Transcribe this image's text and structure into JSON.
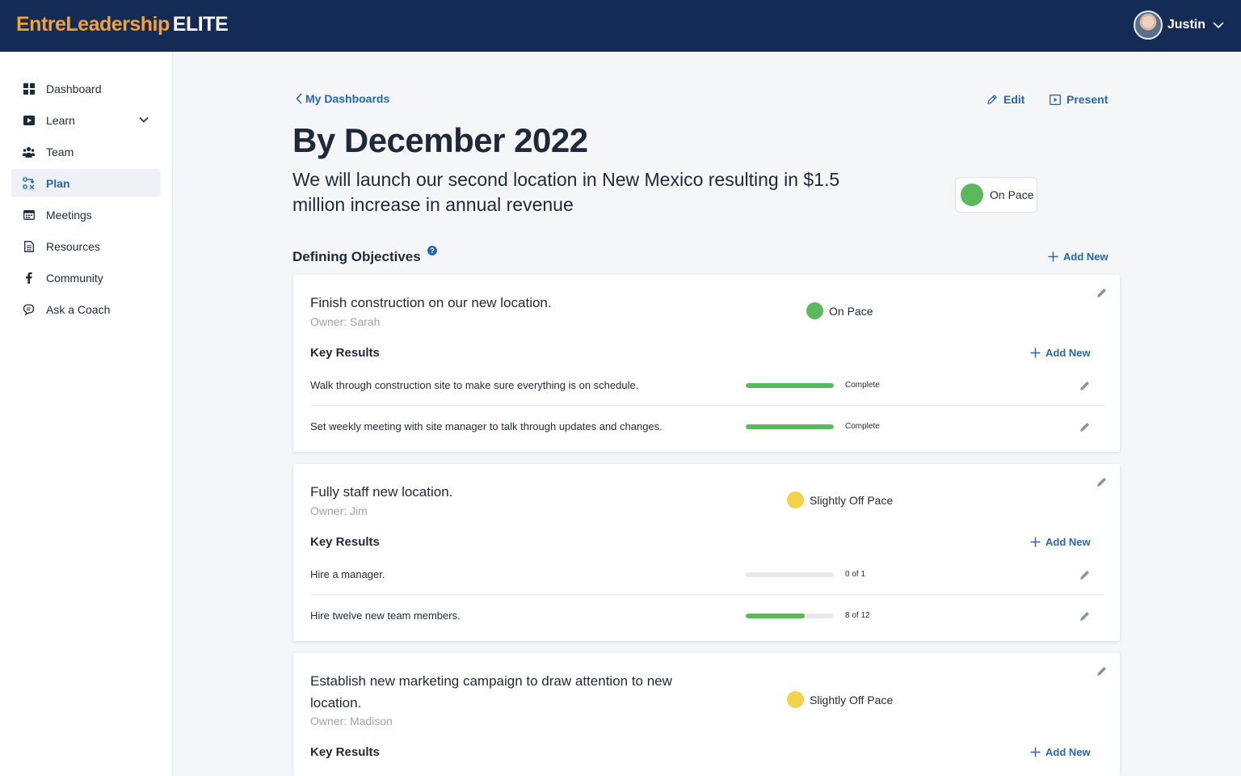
{
  "app": {
    "brand": "EntreLeadership",
    "brand_suffix": "ELITE",
    "user_name": "Justin"
  },
  "sidebar": {
    "items": [
      {
        "label": "Dashboard",
        "icon": "grid-icon"
      },
      {
        "label": "Learn",
        "icon": "play-icon"
      },
      {
        "label": "Team",
        "icon": "team-icon"
      },
      {
        "label": "Plan",
        "icon": "plan-icon",
        "active": true
      },
      {
        "label": "Meetings",
        "icon": "calendar-icon"
      },
      {
        "label": "Resources",
        "icon": "document-icon"
      },
      {
        "label": "Community",
        "icon": "facebook-icon"
      },
      {
        "label": "Ask a Coach",
        "icon": "chat-icon"
      }
    ]
  },
  "header": {
    "back_label": "My Dashboards",
    "edit_label": "Edit",
    "present_label": "Present"
  },
  "goal": {
    "title": "By December 2022",
    "statement": "We will launch our second location in New Mexico resulting in $1.5 million increase in annual revenue",
    "status": "On Pace"
  },
  "objectives_section": {
    "title": "Defining Objectives",
    "help": "?",
    "add_label": "Add New"
  },
  "objectives": [
    {
      "title": "Finish construction on our new location.",
      "owner": "Owner: Sarah",
      "status": "On Pace",
      "status_color": "#5cb85c",
      "key_results_title": "Key Results",
      "add_label": "Add New",
      "key_results": [
        {
          "text": "Walk through construction site to make sure everything is on schedule.",
          "progress": 1.0,
          "value": "Complete"
        },
        {
          "text": "Set weekly meeting with site manager to talk through updates and changes.",
          "progress": 1.0,
          "value": "Complete"
        }
      ]
    },
    {
      "title": "Fully staff new location.",
      "owner": "Owner: Jim",
      "status": "Slightly Off Pace",
      "status_color": "#f5d04a",
      "key_results_title": "Key Results",
      "add_label": "Add New",
      "key_results": [
        {
          "text": "Hire a manager.",
          "progress": 0.0,
          "value": "0 of 1"
        },
        {
          "text": "Hire twelve new team members.",
          "progress": 0.6667,
          "value": "8 of 12"
        }
      ]
    },
    {
      "title": "Establish new marketing campaign to draw attention to new location.",
      "owner": "Owner: Madison",
      "status": "Slightly Off Pace",
      "status_color": "#f5d04a",
      "key_results_title": "Key Results",
      "add_label": "Add New"
    }
  ],
  "colors": {
    "topbar": "#142c55",
    "brand": "#f0a23a",
    "accent": "#2765b5",
    "on_pace": "#5cb85c",
    "off_pace": "#f5d04a"
  }
}
